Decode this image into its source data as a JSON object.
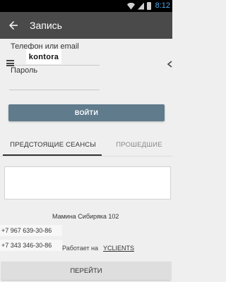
{
  "status_bar": {
    "time": "8:12",
    "icons": [
      "wifi-icon",
      "signal-icon",
      "battery-icon"
    ],
    "time_color": "#4fa8e8"
  },
  "app_bar": {
    "title": "Запись",
    "back_icon": "back-arrow-icon",
    "background": "#4a4a4a"
  },
  "login_form": {
    "phone_label": "Телефон или email",
    "password_label": "Пароль",
    "login_button": "ВОЙТИ",
    "button_color": "#5f7b8c"
  },
  "brand": {
    "logo_text": "kontora"
  },
  "tabs": {
    "upcoming": "ПРЕДСТОЯЩИЕ СЕАНСЫ",
    "past": "ПРОШЕДШИЕ",
    "active": "upcoming"
  },
  "contacts": {
    "address": "Мамина Сибиряка 102",
    "phones": [
      "+7 967 639-30-86",
      "+7 343 346-30-86"
    ],
    "powered_prefix": "Работает на",
    "powered_link": "YCLIENTS"
  },
  "footer": {
    "go_button": "ПЕРЕЙТИ"
  }
}
